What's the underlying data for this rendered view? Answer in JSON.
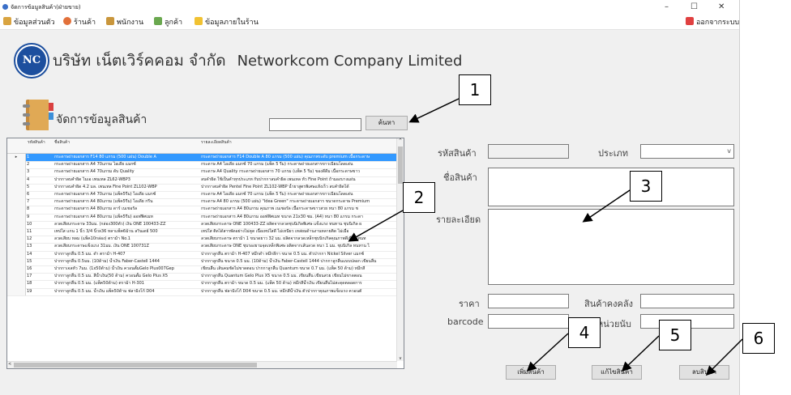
{
  "window": {
    "title": "จัดการข้อมูลสินค้า(ฝ่ายขาย)",
    "controls": [
      "–",
      "☐",
      "✕"
    ]
  },
  "menu": {
    "items": [
      "ข้อมูลส่วนตัว",
      "ร้านค้า",
      "พนักงาน",
      "ลูกค้า",
      "ข้อมูลภายในร้าน"
    ],
    "logout": "ออกจากระบบ"
  },
  "header": {
    "company_th": "บริษัท เน็ตเวิร์คคอม จำกัด",
    "company_en": "Networkcom Company Limited",
    "logo_text": "NC"
  },
  "section": {
    "title": "จัดการข้อมูลสินค้า",
    "search_button": "ค้นหา",
    "search_value": ""
  },
  "table": {
    "columns": [
      "รหัสสินค้า",
      "ชื่อสินค้า",
      "รายละเอียดสินค้า"
    ],
    "rows": [
      [
        "1",
        "กระดาษถ่ายเอกสาร F14 80 แกรม (500 แผ่น) Double A",
        "กระดาษถ่ายเอกสาร F14 Double A 80 แกรม (500 แผ่น) คุณภาพระดับ premium เนื้อกระดาษ"
      ],
      [
        "2",
        "กระดาษถ่ายเอกสาร A4 70แกรม ไอเดีย แมกซ์",
        "กระดาษ A4 ไอเดีย แมกซ์ 70 แกรม (แพ็ค 5 รีม) กระดาษถ่ายเอกสารขาวเนียนโดดเด่น"
      ],
      [
        "3",
        "กระดาษถ่ายเอกสาร A4 70แกรม ดับ Quality",
        "กระดาษ A4 Quality กระดาษถ่ายเอกสาร 70 แกรม (แพ็ค 5 รีม) ของดีดีม เนื้อกระดาษขาว"
      ],
      [
        "4",
        "ปากกาลบคำผิด ไมเอ เพนเทล ZL62-WBP3",
        "ลบคำผิด ใช้เป็นคำทุกประเภท กับปากกาลบคำผิด เพนเทล หัว Fine Point ถ้ามองบางแผ่น"
      ],
      [
        "5",
        "ปากกาลบคำผิด 4.2 มล. เพนเทล Fine Point ZL102-WBP",
        "ปากกาลบคำผิด Pentel Fine Point ZL102-WBP น้ำยาสูตรพิเศษแห้งเร็ว ลบคำผิดได้"
      ],
      [
        "6",
        "กระดาษถ่ายเอกสาร A4 70แกรม (แพ็ค5รีม) ไอเดีย แมกซ์",
        "กระดาษ A4 ไอเดีย แมกซ์ 70 แกรม (แพ็ค 5 รีม) กระดาษถ่ายเอกสารขาวเนียนโดดเด่น"
      ],
      [
        "7",
        "กระดาษถ่ายเอกสาร A4 80แกรม (แพ็ค5รีม) ไอเดีย กรีน",
        "กระดาษ A4 80 แกรม (500 แผ่น) \"Idea Green\" กระดาษถ่ายเอกสาร ขนาดกระดาษ Premium"
      ],
      [
        "8",
        "กระดาษถ่ายเอกสาร A4 80แกรม ดาร์ เนเชอรัล",
        "กระดาษถ่ายเอกสาร A4 80แกรม คุณภาพ เนเชอรัล เนื้อกระดาษขาวสวย หนา 80 แกรม ช"
      ],
      [
        "9",
        "กระดาษถ่ายเอกสาร A4 80แกรม (แพ็ค5รีม) ออฟฟิศเมท",
        "กระดาษถ่ายเอกสาร A4 80แกรม ออฟฟิศเมท ขนาด 21x30 ซม. (A4) หนา 80 แกรม กระดา"
      ],
      [
        "10",
        "ลวดเสียบกระดาษ 33มม. (กล่อง300ตัว) เงิน ONE 100433-ZZ",
        "ลวดเสียบกระดาษ ONE 100433-ZZ ผลิตจากลวดชุบนิเกิลพิเศษ แข็งแรง ทนทาน ชุบนิเกิล ผ"
      ],
      [
        "11",
        "เทปใส แกน 1 นิ้ว 3/4 นิ้วx36 หลาแพ็ค6ม้วน ลวินเดย์ 500",
        "เทปใส ติดได้สารพัดอย่างไม่คูด เนื้อเทปใสดี ไม่เหนียว เหล่ยมด้านงานหลายติด ไม่เมื่อ"
      ],
      [
        "12",
        "ลวดเสียบ หลม (แพ็ค10กล่อง) ตราม้า No.1",
        "ลวดเสียบกระดาษ ตราม้า 1 ขนาดยาว 32 มม. ผลิตจากลวดเหล็กชุบนิกเกิลคุณภาพดีเยี่ยม ทนท"
      ],
      [
        "13",
        "ลวดเสียบกระดาษแข็งแรง 31มม. เงิน ONE 100731Z",
        "ลวดเสียบกระดาษ ONE ชุบรองยามจุดเหล็กพิเศษ ผลิตจากเส้นลวด หนา 1 มม. ชุบนิเกิล ทนทาน ไ"
      ],
      [
        "14",
        "ปากกาลูกลื่น 0.5 มม. ดำ ตราม้า H-407",
        "ปากกาลูกลื่น ตราม้า H-407 หมึกดำ หมึกลีกา ขนาด 0.5 มม. ตัวปากกา Nickel Silver แมกซ์"
      ],
      [
        "15",
        "ปากกาลูกลื่น 0.5มม. (10ด้าม) น้ำเงิน Faber-Castell 1444",
        "ปากกาลูกลื่น ขนาด 0.5 มม. (10ด้าม) น้ำเงิน Faber-Castell 1444 ปากกาลูกลื่นแบบปลอก เขียนลื่น"
      ],
      [
        "16",
        "ปากกาเจลหัว 7มม. (1x50ด้าม) น้ำเงิน ควอนตั้มGelo Plus007Gep",
        "เขียนลื่น เส้นคมชัดไม่ขาดตอน ปากกาลูกลื่น Quantum ขนาด 0.7 มม. (แพ็ค 50 ด้าม) หมึกสี"
      ],
      [
        "17",
        "ปากกาลูกลื่น 0.5 มม. สีน้ำเงิน(50 ด้าม) ควอนตั้ม Gelo Plus X5",
        "ปากกาลูกลื่น Quantum Gelo Plus X5 ขนาด 0.5 มม. เขียนลื่น เขียนสวย เขียนไม่ขาดตอน"
      ],
      [
        "18",
        "ปากกาลูกลื่น 0.5 มม. (แพ็ค50ด้าม) ตราม้า H-301",
        "ปากกาลูกลื่น ตราม้า ขนาด 0.5 มม. (แพ็ค 50 ด้าม) หมึกสีน้ำเงิน เขียนลื่นไม่สะดุดตลอดการ"
      ],
      [
        "19",
        "ปากกาลูกลื่น 0.5 มม. น้ำเงิน แพ็ค50ด้าม ฟลามิงโก้ D04",
        "ปากกาลูกลื่น ฟลามิงโก้ D04 ขนาด 0.5 มม. หมึกสีน้ำเงิน ตัวปากกาคุณภาพแข็งแรง ควอนตั"
      ]
    ],
    "scroll_up": "^",
    "scroll_down": "v",
    "scroll_left": "<"
  },
  "form": {
    "product_code_label": "รหัสสินค้า",
    "type_label": "ประเภท",
    "name_label": "ชื่อสินค้า",
    "detail_label": "รายละเอียด",
    "price_label": "ราคา",
    "stock_label": "สินค้าคงคลัง",
    "barcode_label": "barcode",
    "unit_label": "หน่วยนับ",
    "type_arrow": "v"
  },
  "buttons": {
    "add": "เพิ่มสินค้า",
    "edit": "แก้ไขสินค้า",
    "delete": "ลบสินค้า"
  },
  "callouts": [
    "1",
    "2",
    "3",
    "4",
    "5",
    "6"
  ],
  "colors": {
    "selection": "#3399ff",
    "logo": "#1d4f9e"
  }
}
